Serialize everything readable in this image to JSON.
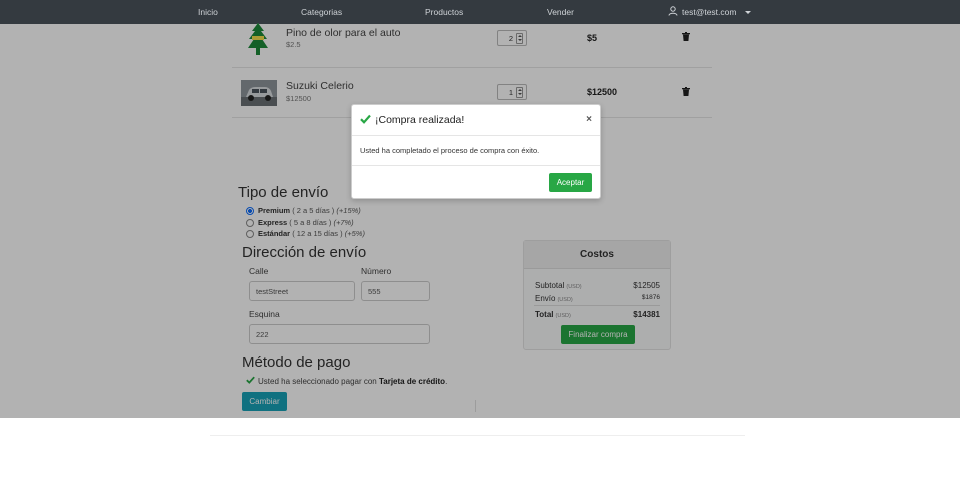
{
  "nav": {
    "links": [
      "Inicio",
      "Categorias",
      "Productos",
      "Vender"
    ],
    "user": "test@test.com",
    "user_icon": "user-icon"
  },
  "cart": {
    "items": [
      {
        "name": "Pino de olor para el auto",
        "price": "$2.5",
        "qty": "2",
        "subtotal": "$5",
        "image": "pine-air-freshener-image"
      },
      {
        "name": "Suzuki Celerio",
        "price": "$12500",
        "qty": "1",
        "subtotal": "$12500",
        "image": "car-image"
      }
    ]
  },
  "shipping": {
    "title": "Tipo de envío",
    "options": [
      {
        "name": "Premium",
        "detail": " ( 2 a 5 días ) ",
        "pct": "(+15%)",
        "selected": true
      },
      {
        "name": "Express",
        "detail": " ( 5 a 8 días ) ",
        "pct": "(+7%)",
        "selected": false
      },
      {
        "name": "Estándar",
        "detail": " ( 12 a 15 días ) ",
        "pct": "(+5%)",
        "selected": false
      }
    ]
  },
  "address": {
    "title": "Dirección de envío",
    "street_label": "Calle",
    "street_value": "testStreet",
    "number_label": "Número",
    "number_value": "555",
    "corner_label": "Esquina",
    "corner_value": "222"
  },
  "payment": {
    "title": "Método de pago",
    "text": "Usted ha seleccionado pagar con ",
    "method": "Tarjeta de crédito",
    "suffix": ".",
    "change_label": "Cambiar"
  },
  "costs": {
    "title": "Costos",
    "subtotal_label": "Subtotal",
    "subtotal_currency": "(USD)",
    "subtotal_value": "$12505",
    "shipping_label": "Envío",
    "shipping_currency": "(USD)",
    "shipping_value": "$1876",
    "total_label": "Total",
    "total_currency": "(USD)",
    "total_value": "$14381",
    "finalize_label": "Finalizar compra"
  },
  "modal": {
    "title": "¡Compra realizada!",
    "close": "×",
    "body": "Usted ha completado el proceso de compra con éxito.",
    "accept_label": "Aceptar"
  },
  "colors": {
    "navbar": "#343a40",
    "success": "#28a745",
    "info": "#17a2b8",
    "radio_selected": "#0d6efd"
  }
}
